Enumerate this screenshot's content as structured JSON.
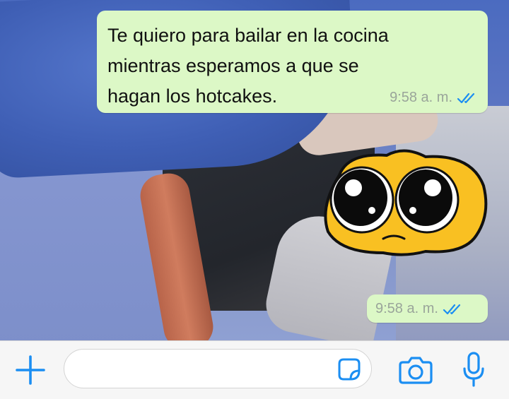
{
  "messages": [
    {
      "text": "Te quiero para bailar en la cocina\nmientras esperamos a que se\nhagan los hotcakes.",
      "time": "9:58 a. m.",
      "status": "read"
    },
    {
      "sticker": "pleading-face-sticker",
      "time": "9:58 a. m.",
      "status": "read"
    }
  ],
  "input": {
    "value": "",
    "placeholder": ""
  },
  "icons": {
    "attach": "plus-icon",
    "sticker": "sticker-icon",
    "camera": "camera-icon",
    "microphone": "microphone-icon",
    "read_receipt": "double-check-icon"
  },
  "colors": {
    "accent": "#1b8ef2",
    "outgoing_bubble": "#dcf8c6",
    "meta_text": "#9aa59a",
    "input_bar": "#f6f6f6"
  }
}
